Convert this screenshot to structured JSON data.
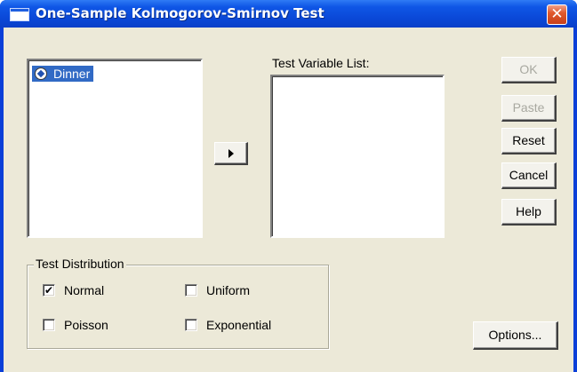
{
  "window": {
    "title": "One-Sample Kolmogorov-Smirnov Test",
    "close_glyph": "✕"
  },
  "source_list": {
    "items": [
      {
        "label": "Dinner",
        "icon": "scale-variable-icon",
        "selected": true
      }
    ]
  },
  "target_list": {
    "label": "Test Variable List:",
    "items": []
  },
  "move_button": {
    "glyph": "right-arrow"
  },
  "buttons": {
    "ok": "OK",
    "paste": "Paste",
    "reset": "Reset",
    "cancel": "Cancel",
    "help": "Help",
    "options": "Options..."
  },
  "test_distribution": {
    "title": "Test Distribution",
    "options": [
      {
        "label": "Normal",
        "checked": true
      },
      {
        "label": "Uniform",
        "checked": false
      },
      {
        "label": "Poisson",
        "checked": false
      },
      {
        "label": "Exponential",
        "checked": false
      }
    ]
  },
  "colors": {
    "titlebar": "#0a47d6",
    "dialog_face": "#ece9d8",
    "selection": "#316ac5",
    "disabled_text": "#a8a8a0"
  }
}
